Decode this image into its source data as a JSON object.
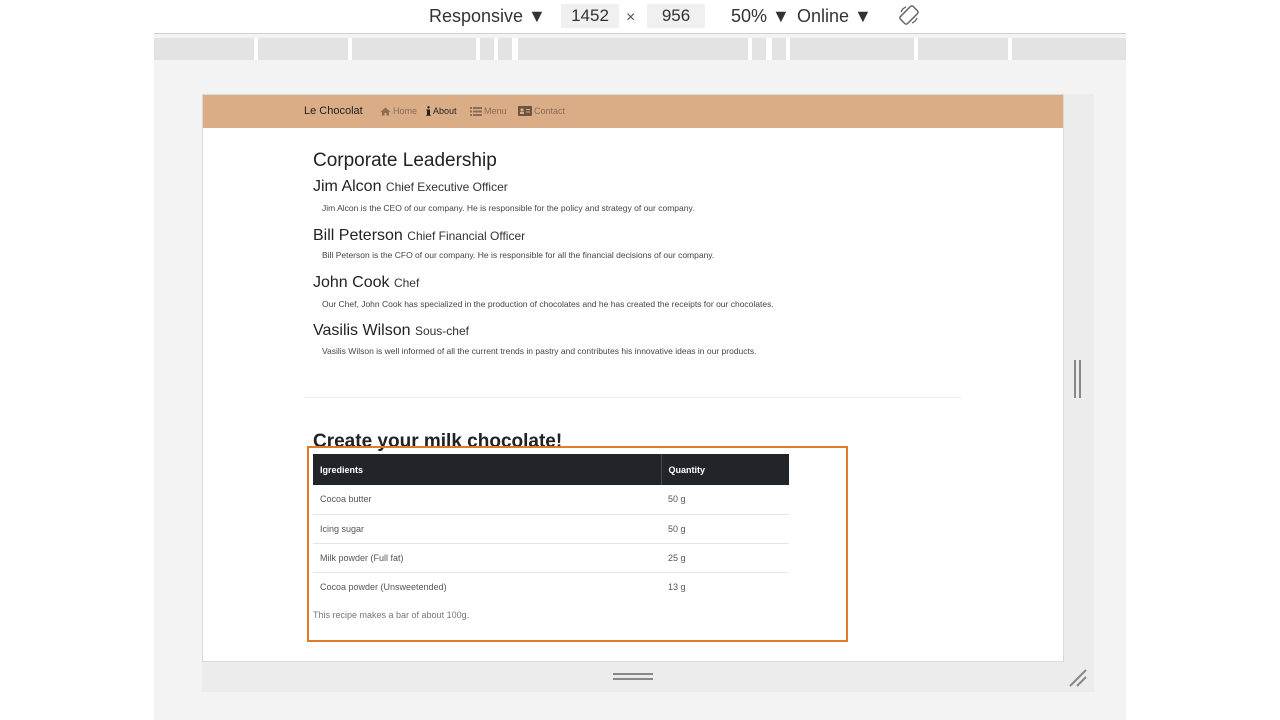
{
  "devtools": {
    "device": "Responsive ▼",
    "width": "1452",
    "times": "×",
    "height": "956",
    "zoom": "50% ▼",
    "network": "Online ▼"
  },
  "nav": {
    "brand": "Le Chocolat",
    "items": [
      {
        "label": "Home",
        "icon": "home-icon"
      },
      {
        "label": "About",
        "icon": "info-icon"
      },
      {
        "label": "Menu",
        "icon": "list-icon"
      },
      {
        "label": "Contact",
        "icon": "address-card-icon"
      }
    ]
  },
  "leadership": {
    "heading": "Corporate Leadership",
    "people": [
      {
        "name": "Jim Alcon",
        "title": "Chief Executive Officer",
        "desc": "Jim Alcon is the CEO of our company. He is responsible for the policy and strategy of our company."
      },
      {
        "name": "Bill Peterson",
        "title": "Chief Financial Officer",
        "desc": "Bill Peterson is the CFO of our company. He is responsible for all the financial decisions of our company."
      },
      {
        "name": "John Cook",
        "title": "Chef",
        "desc": "Our Chef, John Cook has specialized in the production of chocolates and he has created the receipts for our chocolates."
      },
      {
        "name": "Vasilis Wilson",
        "title": "Sous-chef",
        "desc": "Vasilis Wilson is well informed of all the current trends in pastry and contributes his innovative ideas in our products."
      }
    ]
  },
  "recipe": {
    "heading": "Create your milk chocolate!",
    "headers": [
      "Igredients",
      "Quantity"
    ],
    "rows": [
      [
        "Cocoa butter",
        "50 g"
      ],
      [
        "Icing sugar",
        "50 g"
      ],
      [
        "Milk powder (Full fat)",
        "25 g"
      ],
      [
        "Cocoa powder (Unsweetended)",
        "13 g"
      ]
    ],
    "note": "This recipe makes a bar of about 100g."
  },
  "colors": {
    "navbar": "#dbad87",
    "table_header": "#212529",
    "highlight": "#e07b2a"
  }
}
